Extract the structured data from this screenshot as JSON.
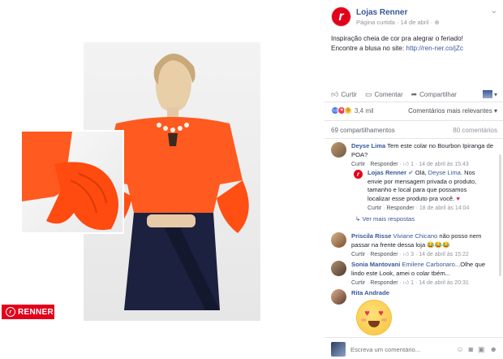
{
  "page": {
    "name": "Lojas Renner",
    "meta": "Página curtida · 14 de abril ·",
    "avatar_letter": "r"
  },
  "post": {
    "line1": "Inspiração cheia de cor pra alegrar o feriado!",
    "line2_prefix": "Encontre a blusa no site: ",
    "link": "http://ren-ner.co/jZc"
  },
  "actions": {
    "like": "Curtir",
    "comment": "Comentar",
    "share": "Compartilhar"
  },
  "reactions": {
    "count": "3,4 mil",
    "sort": "Comentários mais relevantes ▾"
  },
  "counts": {
    "shares": "69 compartilhamentos",
    "comments": "80 comentários"
  },
  "brand": {
    "label": "RENNER",
    "mark": "r",
    "color": "#e3001b"
  },
  "comments": [
    {
      "name": "Deyse Lima",
      "text": "Tem este colar no Bourbon Ipiranga de POA?",
      "like": "Curtir",
      "reply": "Responder",
      "likes": "1",
      "time": "14 de abril às 15:43"
    },
    {
      "name": "Priscila Risse",
      "tag": "Viviane Chicano",
      "text": "não posso nem passar na frente dessa loja",
      "emojis": "😂😂😂",
      "like": "Curtir",
      "reply": "Responder",
      "likes": "3",
      "time": "14 de abril às 15:22"
    },
    {
      "name": "Sonia Mantovani",
      "tag": "Emilene Carbonaro",
      "text": "...Olhe que lindo este Look, amei o colar tbém...",
      "like": "Curtir",
      "reply": "Responder",
      "likes": "1",
      "time": "14 de abril às 20:31"
    },
    {
      "name": "Rita Andrade"
    }
  ],
  "reply": {
    "name": "Lojas Renner",
    "greeting": "Olá, ",
    "tag": "Deyse Lima",
    "text": ". Nos envie por mensagem privada o produto, tamanho e local para que possamos localizar esse produto pra você.",
    "like": "Curtir",
    "reply": "Responder",
    "time": "18 de abril às 14:04",
    "more": "Ver mais respostas"
  },
  "composer": {
    "placeholder": "Escreva um comentário..."
  }
}
